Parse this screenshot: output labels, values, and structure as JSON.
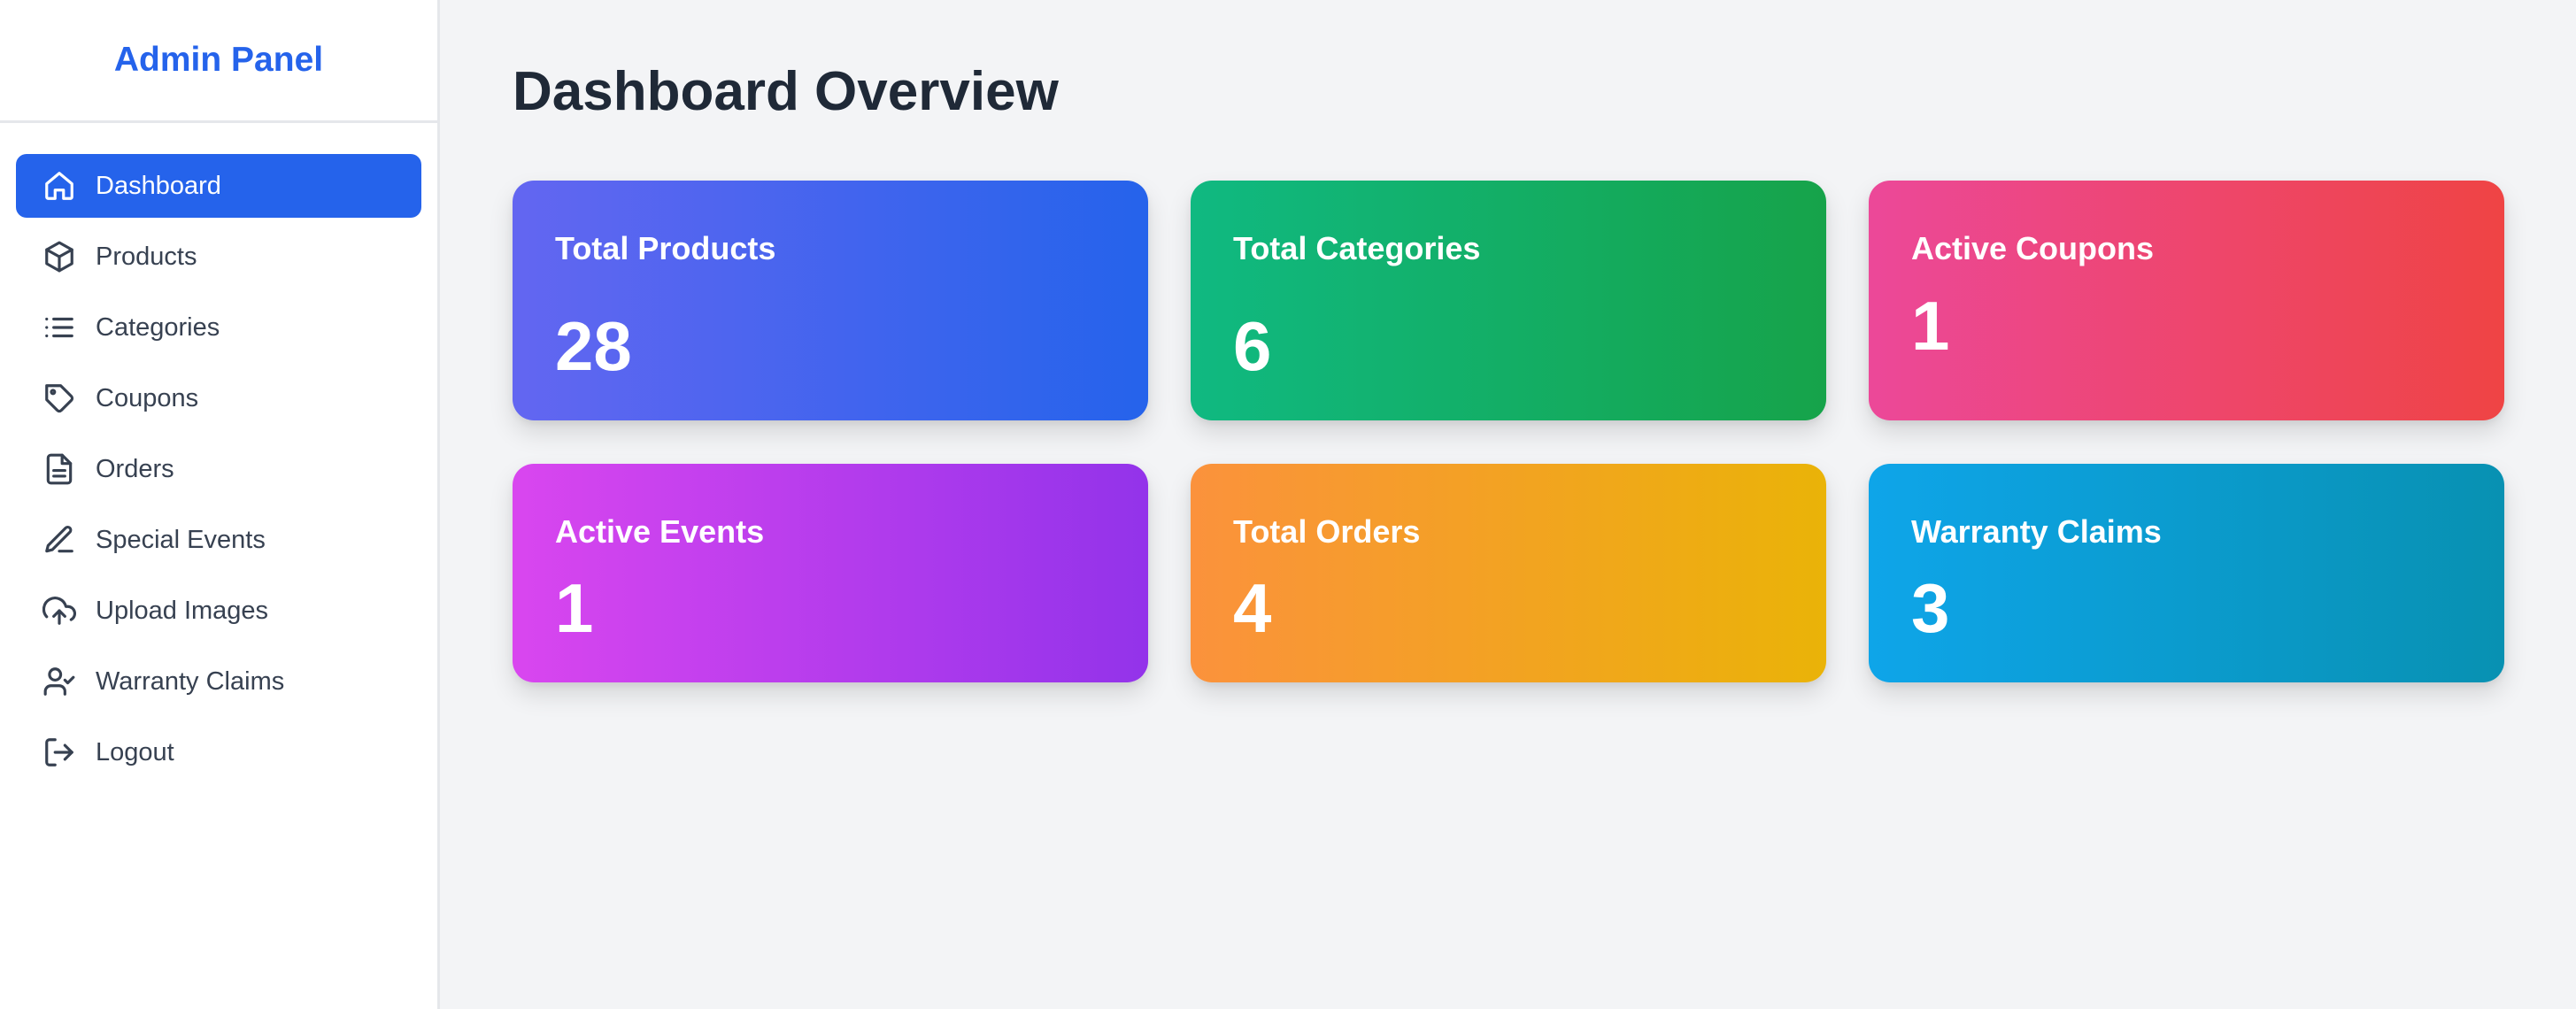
{
  "sidebar": {
    "title": "Admin Panel",
    "items": [
      {
        "label": "Dashboard",
        "icon": "home-icon",
        "active": true
      },
      {
        "label": "Products",
        "icon": "box-icon",
        "active": false
      },
      {
        "label": "Categories",
        "icon": "list-icon",
        "active": false
      },
      {
        "label": "Coupons",
        "icon": "tag-icon",
        "active": false
      },
      {
        "label": "Orders",
        "icon": "document-icon",
        "active": false
      },
      {
        "label": "Special Events",
        "icon": "pen-icon",
        "active": false
      },
      {
        "label": "Upload Images",
        "icon": "cloud-upload-icon",
        "active": false
      },
      {
        "label": "Warranty Claims",
        "icon": "user-check-icon",
        "active": false
      },
      {
        "label": "Logout",
        "icon": "logout-icon",
        "active": false
      }
    ]
  },
  "main": {
    "title": "Dashboard Overview",
    "cards": [
      {
        "label": "Total Products",
        "value": "28",
        "gradient": [
          "#6366f1",
          "#2563eb"
        ]
      },
      {
        "label": "Total Categories",
        "value": "6",
        "gradient": [
          "#10b981",
          "#16a34a"
        ]
      },
      {
        "label": "Active Coupons",
        "value": "1",
        "gradient": [
          "#ec4899",
          "#ef4444"
        ]
      },
      {
        "label": "Active Events",
        "value": "1",
        "gradient": [
          "#d946ef",
          "#9333ea"
        ]
      },
      {
        "label": "Total Orders",
        "value": "4",
        "gradient": [
          "#fb923c",
          "#eab308"
        ]
      },
      {
        "label": "Warranty Claims",
        "value": "3",
        "gradient": [
          "#0ea5e9",
          "#0891b2"
        ]
      }
    ]
  }
}
